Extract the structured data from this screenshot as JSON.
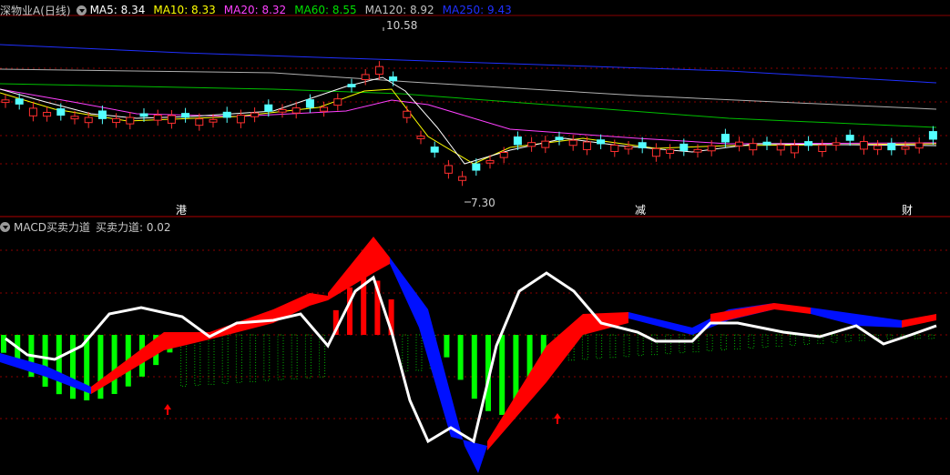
{
  "main_panel": {
    "title": "深物业A(日线)",
    "indicators": [
      {
        "label": "MA5: 8.34",
        "color": "#ffffff"
      },
      {
        "label": "MA10: 8.33",
        "color": "#ffff00"
      },
      {
        "label": "MA20: 8.32",
        "color": "#ff40ff"
      },
      {
        "label": "MA60: 8.55",
        "color": "#00e000"
      },
      {
        "label": "MA120: 8.92",
        "color": "#c0c0c0"
      },
      {
        "label": "MA250: 9.43",
        "color": "#2030ff"
      }
    ],
    "high_label": "10.58",
    "low_label": "7.30",
    "markers": [
      "港",
      "减",
      "财"
    ]
  },
  "sub_panel": {
    "title": "MACD买卖力道",
    "value_label": "买卖力道: 0.02"
  },
  "colors": {
    "background": "#000000",
    "up_candle": "#ff3030",
    "down_candle": "#54ffff",
    "grid": "#8a0000",
    "macd_red": "#ff0000",
    "macd_blue": "#0010ff",
    "hist_green": "#00ff00",
    "line_white": "#ffffff",
    "arrow": "#ff0000"
  },
  "chart_data": {
    "type": "candlestick",
    "y_range": [
      7.0,
      11.0
    ],
    "high": 10.58,
    "low": 7.3,
    "ma_latest": {
      "MA5": 8.34,
      "MA10": 8.33,
      "MA20": 8.32,
      "MA60": 8.55,
      "MA120": 8.92,
      "MA250": 9.43
    }
  }
}
